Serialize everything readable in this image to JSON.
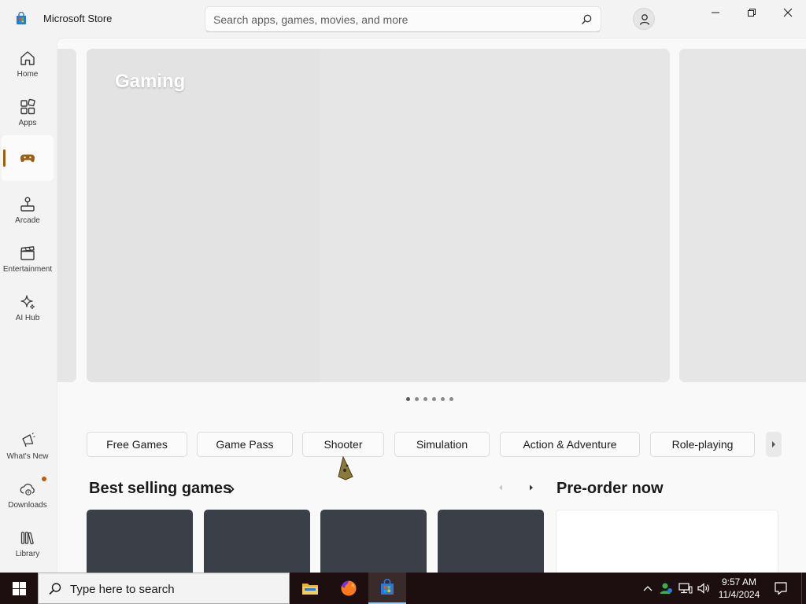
{
  "window": {
    "title": "Microsoft Store",
    "search_placeholder": "Search apps, games, movies, and more"
  },
  "sidebar": {
    "items": [
      {
        "label": "Home",
        "icon": "home-icon"
      },
      {
        "label": "Apps",
        "icon": "apps-icon"
      },
      {
        "label": "",
        "icon": "gamepad-icon",
        "active": true
      },
      {
        "label": "Arcade",
        "icon": "joystick-icon"
      },
      {
        "label": "Entertainment",
        "icon": "clapperboard-icon"
      },
      {
        "label": "AI Hub",
        "icon": "sparkle-icon"
      }
    ],
    "bottom_items": [
      {
        "label": "What's New",
        "icon": "megaphone-icon"
      },
      {
        "label": "Downloads",
        "icon": "cloud-download-icon",
        "badge": true
      },
      {
        "label": "Library",
        "icon": "library-icon"
      }
    ]
  },
  "hero": {
    "title": "Gaming",
    "dot_count": 6,
    "active_dot": 0
  },
  "categories": [
    "Free Games",
    "Game Pass",
    "Shooter",
    "Simulation",
    "Action & Adventure",
    "Role-playing"
  ],
  "sections": {
    "best_selling": "Best selling games",
    "pre_order": "Pre-order now"
  },
  "taskbar": {
    "search_text": "Type here to search",
    "time": "9:57 AM",
    "date": "11/4/2024",
    "apps": [
      "file-explorer-icon",
      "firefox-icon",
      "store-icon"
    ]
  },
  "colors": {
    "accent": "#9a6010",
    "taskbar": "#1d0f0f",
    "card": "#3b3f48",
    "badge": "#c25b12"
  }
}
